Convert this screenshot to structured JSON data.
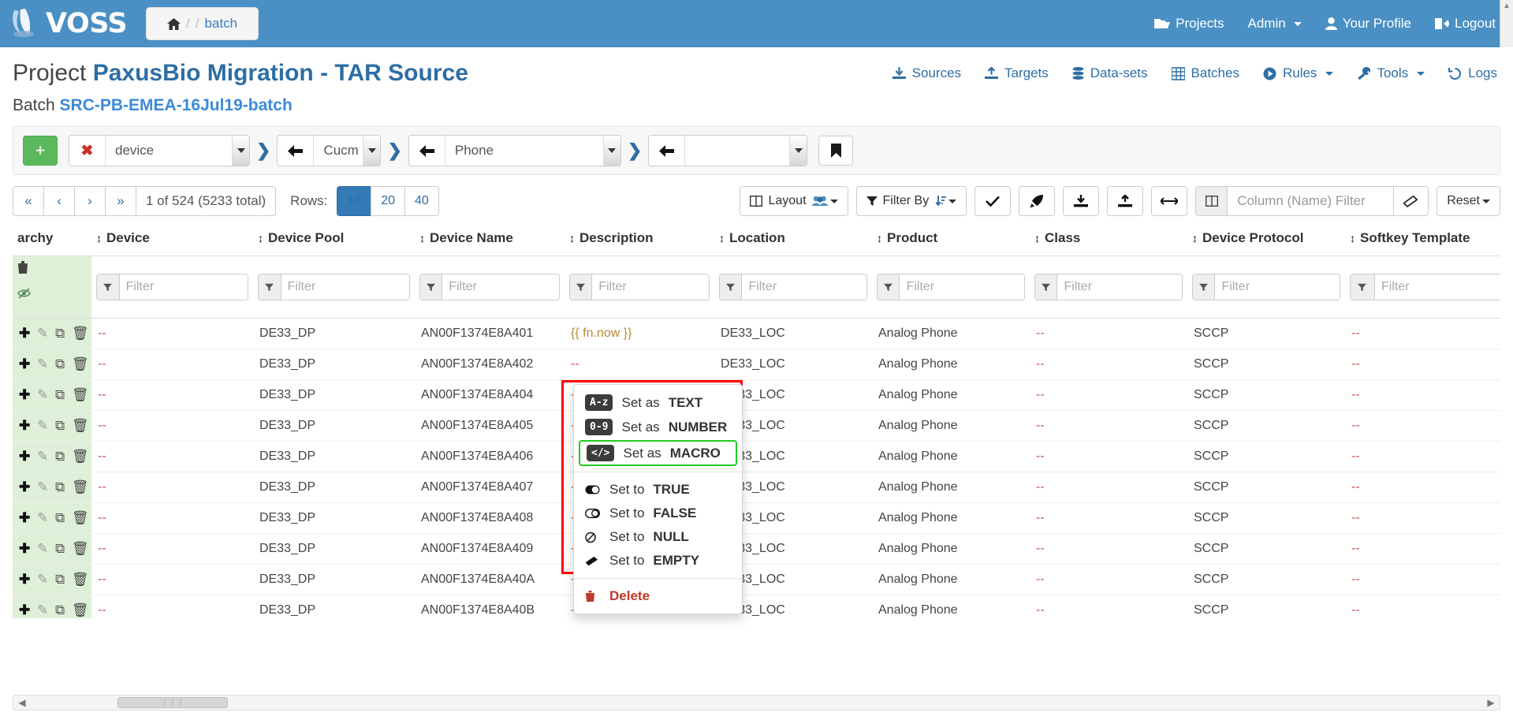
{
  "navbar": {
    "brand": "VOSS",
    "breadcrumb": {
      "home_icon": "home-icon",
      "sep": "/",
      "sep2": "/",
      "current": "batch"
    },
    "items": [
      {
        "label": "Projects",
        "icon": "folder-open-icon",
        "caret": false
      },
      {
        "label": "Admin",
        "icon": "",
        "caret": true
      },
      {
        "label": "Your Profile",
        "icon": "user-icon",
        "caret": false
      },
      {
        "label": "Logout",
        "icon": "logout-icon",
        "caret": false
      }
    ]
  },
  "project": {
    "prefix": "Project",
    "name": "PaxusBio Migration - TAR Source",
    "batch_prefix": "Batch",
    "batch_name": "SRC-PB-EMEA-16Jul19-batch",
    "nav": [
      {
        "label": "Sources",
        "icon": "download-icon",
        "caret": false
      },
      {
        "label": "Targets",
        "icon": "upload-icon",
        "caret": false
      },
      {
        "label": "Data-sets",
        "icon": "database-icon",
        "caret": false
      },
      {
        "label": "Batches",
        "icon": "table-icon",
        "caret": false
      },
      {
        "label": "Rules",
        "icon": "play-circle-icon",
        "caret": true
      },
      {
        "label": "Tools",
        "icon": "wrench-icon",
        "caret": true
      },
      {
        "label": "Logs",
        "icon": "history-icon",
        "caret": false
      }
    ]
  },
  "selector_bar": {
    "add_label": "+",
    "clear_label": "✖",
    "selects": [
      {
        "value": "device",
        "icon": "clear-x-icon"
      },
      {
        "value": "Cucm",
        "icon": "back-arrow-icon"
      },
      {
        "value": "Phone",
        "icon": "back-arrow-icon"
      },
      {
        "value": "",
        "icon": "back-arrow-icon"
      }
    ],
    "bookmark_icon": "bookmark-icon"
  },
  "pager": {
    "first": "«",
    "prev": "‹",
    "next": "›",
    "last": "»",
    "info": "1 of 524 (5233 total)",
    "rows_label": "Rows:",
    "row_options": [
      "10",
      "20",
      "40"
    ],
    "rows_selected": "10"
  },
  "toolbar": {
    "layout_label": "Layout",
    "filter_by_label": "Filter By",
    "check_icon": "check-icon",
    "rocket_icon": "rocket-icon",
    "import_icon": "download-import-icon",
    "export_icon": "upload-export-icon",
    "resize_icon": "arrows-h-icon",
    "column_filter_placeholder": "Column (Name) Filter",
    "column_filter_value": "",
    "eraser_icon": "eraser-icon",
    "reset_label": "Reset"
  },
  "table": {
    "columns": [
      "archy",
      "Device",
      "Device Pool",
      "Device Name",
      "Description",
      "Location",
      "Product",
      "Class",
      "Device Protocol",
      "Softkey Template"
    ],
    "filter_placeholder": "Filter",
    "rows": [
      {
        "device": "--",
        "device_pool": "DE33_DP",
        "device_name": "AN00F1374E8A401",
        "description": "{{ fn.now }}",
        "location": "DE33_LOC",
        "product": "Analog Phone",
        "class": "--",
        "protocol": "SCCP",
        "softkey": "--"
      },
      {
        "device": "--",
        "device_pool": "DE33_DP",
        "device_name": "AN00F1374E8A402",
        "description": "--",
        "location": "DE33_LOC",
        "product": "Analog Phone",
        "class": "--",
        "protocol": "SCCP",
        "softkey": "--"
      },
      {
        "device": "--",
        "device_pool": "DE33_DP",
        "device_name": "AN00F1374E8A404",
        "description": "--",
        "location": "DE33_LOC",
        "product": "Analog Phone",
        "class": "--",
        "protocol": "SCCP",
        "softkey": "--"
      },
      {
        "device": "--",
        "device_pool": "DE33_DP",
        "device_name": "AN00F1374E8A405",
        "description": "--",
        "location": "DE33_LOC",
        "product": "Analog Phone",
        "class": "--",
        "protocol": "SCCP",
        "softkey": "--"
      },
      {
        "device": "--",
        "device_pool": "DE33_DP",
        "device_name": "AN00F1374E8A406",
        "description": "--",
        "location": "DE33_LOC",
        "product": "Analog Phone",
        "class": "--",
        "protocol": "SCCP",
        "softkey": "--"
      },
      {
        "device": "--",
        "device_pool": "DE33_DP",
        "device_name": "AN00F1374E8A407",
        "description": "--",
        "location": "DE33_LOC",
        "product": "Analog Phone",
        "class": "--",
        "protocol": "SCCP",
        "softkey": "--"
      },
      {
        "device": "--",
        "device_pool": "DE33_DP",
        "device_name": "AN00F1374E8A408",
        "description": "--",
        "location": "DE33_LOC",
        "product": "Analog Phone",
        "class": "--",
        "protocol": "SCCP",
        "softkey": "--"
      },
      {
        "device": "--",
        "device_pool": "DE33_DP",
        "device_name": "AN00F1374E8A409",
        "description": "--",
        "location": "DE33_LOC",
        "product": "Analog Phone",
        "class": "--",
        "protocol": "SCCP",
        "softkey": "--"
      },
      {
        "device": "--",
        "device_pool": "DE33_DP",
        "device_name": "AN00F1374E8A40A",
        "description": "--",
        "location": "DE33_LOC",
        "product": "Analog Phone",
        "class": "--",
        "protocol": "SCCP",
        "softkey": "--"
      },
      {
        "device": "--",
        "device_pool": "DE33_DP",
        "device_name": "AN00F1374E8A40B",
        "description": "--",
        "location": "DE33_LOC",
        "product": "Analog Phone",
        "class": "--",
        "protocol": "SCCP",
        "softkey": "--"
      }
    ]
  },
  "context_menu": {
    "items": [
      {
        "badge": "A-z",
        "prefix": "Set as ",
        "value": "TEXT",
        "selected": false,
        "kind": "badge"
      },
      {
        "badge": "0-9",
        "prefix": "Set as ",
        "value": "NUMBER",
        "selected": false,
        "kind": "badge"
      },
      {
        "badge": "</>",
        "prefix": "Set as ",
        "value": "MACRO",
        "selected": true,
        "kind": "badge"
      },
      {
        "badge": "toggle-on-icon",
        "prefix": "Set to ",
        "value": "TRUE",
        "selected": false,
        "kind": "icon"
      },
      {
        "badge": "toggle-off-icon",
        "prefix": "Set to ",
        "value": "FALSE",
        "selected": false,
        "kind": "icon"
      },
      {
        "badge": "null-icon",
        "prefix": "Set to ",
        "value": "NULL",
        "selected": false,
        "kind": "icon"
      },
      {
        "badge": "eraser-icon",
        "prefix": "Set to ",
        "value": "EMPTY",
        "selected": false,
        "kind": "icon"
      },
      {
        "badge": "trash-icon",
        "prefix": "",
        "value": "Delete",
        "selected": false,
        "kind": "danger"
      }
    ]
  },
  "colors": {
    "navbar": "#4a90c4",
    "brand_blue": "#2e6da4",
    "link_blue": "#3b8ad9",
    "green": "#5cb85c",
    "highlight_red": "#ff0000",
    "selected_green": "#22cc22",
    "row_action_bg": "#dff0d8"
  }
}
